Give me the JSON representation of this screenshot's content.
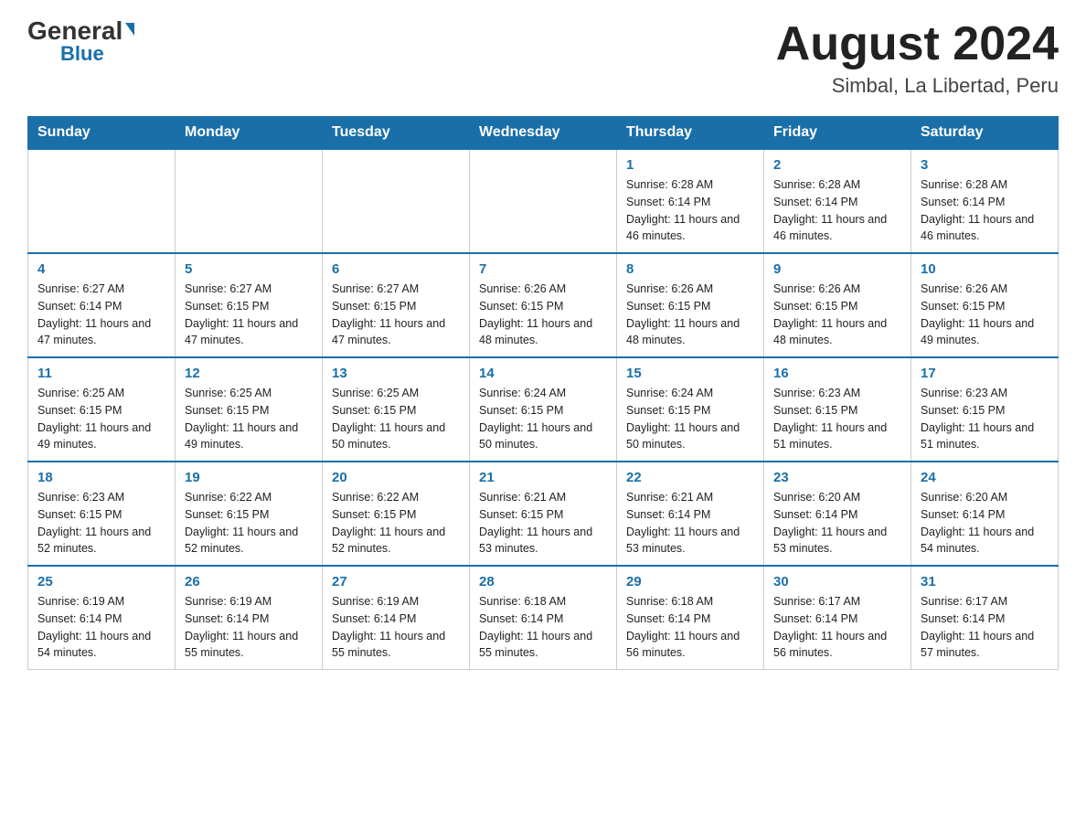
{
  "header": {
    "logo_general": "General",
    "logo_blue": "Blue",
    "month_title": "August 2024",
    "location": "Simbal, La Libertad, Peru"
  },
  "days_of_week": [
    "Sunday",
    "Monday",
    "Tuesday",
    "Wednesday",
    "Thursday",
    "Friday",
    "Saturday"
  ],
  "weeks": [
    [
      {
        "day": "",
        "info": ""
      },
      {
        "day": "",
        "info": ""
      },
      {
        "day": "",
        "info": ""
      },
      {
        "day": "",
        "info": ""
      },
      {
        "day": "1",
        "info": "Sunrise: 6:28 AM\nSunset: 6:14 PM\nDaylight: 11 hours and 46 minutes."
      },
      {
        "day": "2",
        "info": "Sunrise: 6:28 AM\nSunset: 6:14 PM\nDaylight: 11 hours and 46 minutes."
      },
      {
        "day": "3",
        "info": "Sunrise: 6:28 AM\nSunset: 6:14 PM\nDaylight: 11 hours and 46 minutes."
      }
    ],
    [
      {
        "day": "4",
        "info": "Sunrise: 6:27 AM\nSunset: 6:14 PM\nDaylight: 11 hours and 47 minutes."
      },
      {
        "day": "5",
        "info": "Sunrise: 6:27 AM\nSunset: 6:15 PM\nDaylight: 11 hours and 47 minutes."
      },
      {
        "day": "6",
        "info": "Sunrise: 6:27 AM\nSunset: 6:15 PM\nDaylight: 11 hours and 47 minutes."
      },
      {
        "day": "7",
        "info": "Sunrise: 6:26 AM\nSunset: 6:15 PM\nDaylight: 11 hours and 48 minutes."
      },
      {
        "day": "8",
        "info": "Sunrise: 6:26 AM\nSunset: 6:15 PM\nDaylight: 11 hours and 48 minutes."
      },
      {
        "day": "9",
        "info": "Sunrise: 6:26 AM\nSunset: 6:15 PM\nDaylight: 11 hours and 48 minutes."
      },
      {
        "day": "10",
        "info": "Sunrise: 6:26 AM\nSunset: 6:15 PM\nDaylight: 11 hours and 49 minutes."
      }
    ],
    [
      {
        "day": "11",
        "info": "Sunrise: 6:25 AM\nSunset: 6:15 PM\nDaylight: 11 hours and 49 minutes."
      },
      {
        "day": "12",
        "info": "Sunrise: 6:25 AM\nSunset: 6:15 PM\nDaylight: 11 hours and 49 minutes."
      },
      {
        "day": "13",
        "info": "Sunrise: 6:25 AM\nSunset: 6:15 PM\nDaylight: 11 hours and 50 minutes."
      },
      {
        "day": "14",
        "info": "Sunrise: 6:24 AM\nSunset: 6:15 PM\nDaylight: 11 hours and 50 minutes."
      },
      {
        "day": "15",
        "info": "Sunrise: 6:24 AM\nSunset: 6:15 PM\nDaylight: 11 hours and 50 minutes."
      },
      {
        "day": "16",
        "info": "Sunrise: 6:23 AM\nSunset: 6:15 PM\nDaylight: 11 hours and 51 minutes."
      },
      {
        "day": "17",
        "info": "Sunrise: 6:23 AM\nSunset: 6:15 PM\nDaylight: 11 hours and 51 minutes."
      }
    ],
    [
      {
        "day": "18",
        "info": "Sunrise: 6:23 AM\nSunset: 6:15 PM\nDaylight: 11 hours and 52 minutes."
      },
      {
        "day": "19",
        "info": "Sunrise: 6:22 AM\nSunset: 6:15 PM\nDaylight: 11 hours and 52 minutes."
      },
      {
        "day": "20",
        "info": "Sunrise: 6:22 AM\nSunset: 6:15 PM\nDaylight: 11 hours and 52 minutes."
      },
      {
        "day": "21",
        "info": "Sunrise: 6:21 AM\nSunset: 6:15 PM\nDaylight: 11 hours and 53 minutes."
      },
      {
        "day": "22",
        "info": "Sunrise: 6:21 AM\nSunset: 6:14 PM\nDaylight: 11 hours and 53 minutes."
      },
      {
        "day": "23",
        "info": "Sunrise: 6:20 AM\nSunset: 6:14 PM\nDaylight: 11 hours and 53 minutes."
      },
      {
        "day": "24",
        "info": "Sunrise: 6:20 AM\nSunset: 6:14 PM\nDaylight: 11 hours and 54 minutes."
      }
    ],
    [
      {
        "day": "25",
        "info": "Sunrise: 6:19 AM\nSunset: 6:14 PM\nDaylight: 11 hours and 54 minutes."
      },
      {
        "day": "26",
        "info": "Sunrise: 6:19 AM\nSunset: 6:14 PM\nDaylight: 11 hours and 55 minutes."
      },
      {
        "day": "27",
        "info": "Sunrise: 6:19 AM\nSunset: 6:14 PM\nDaylight: 11 hours and 55 minutes."
      },
      {
        "day": "28",
        "info": "Sunrise: 6:18 AM\nSunset: 6:14 PM\nDaylight: 11 hours and 55 minutes."
      },
      {
        "day": "29",
        "info": "Sunrise: 6:18 AM\nSunset: 6:14 PM\nDaylight: 11 hours and 56 minutes."
      },
      {
        "day": "30",
        "info": "Sunrise: 6:17 AM\nSunset: 6:14 PM\nDaylight: 11 hours and 56 minutes."
      },
      {
        "day": "31",
        "info": "Sunrise: 6:17 AM\nSunset: 6:14 PM\nDaylight: 11 hours and 57 minutes."
      }
    ]
  ]
}
